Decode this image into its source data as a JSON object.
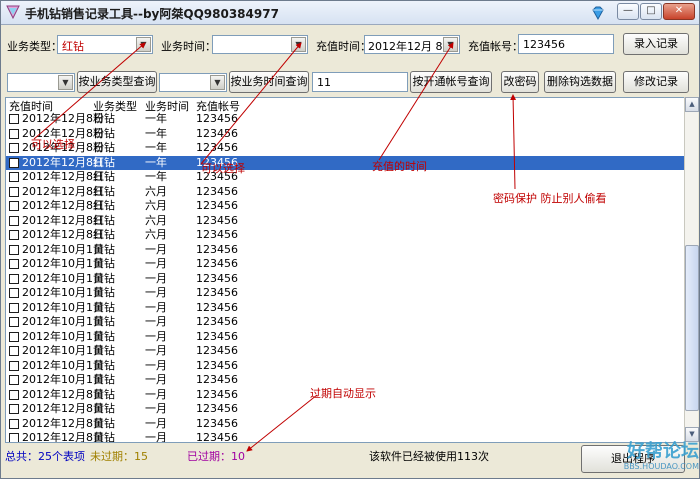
{
  "window": {
    "title": "手机钻销售记录工具--by阿桀QQ980384977",
    "min_glyph": "—",
    "max_glyph": "□",
    "close_glyph": "✕"
  },
  "toolbar": {
    "type_label": "业务类型：",
    "type_value": "红钻",
    "time_label": "业务时间：",
    "time_value": "",
    "recharge_time_label": "充值时间：",
    "recharge_time_value": "2012年12月 8日",
    "account_label": "充值帐号：",
    "account_value": "123456",
    "enter_button": "录入记录"
  },
  "filters": {
    "type_filter_value": "",
    "type_query_button": "按业务类型查询",
    "time_filter_value": "",
    "time_query_button": "按业务时间查询",
    "account_filter_value": "11",
    "account_query_button": "按开通帐号查询",
    "change_password_button": "改密码",
    "delete_checked_button": "删除钩选数据",
    "modify_record_button": "修改记录"
  },
  "table": {
    "columns": [
      "充值时间",
      "业务类型",
      "业务时间",
      "充值帐号"
    ],
    "selected_index": 3,
    "rows": [
      [
        "2012年12月8日",
        "粉钻",
        "一年",
        "123456"
      ],
      [
        "2012年12月8日",
        "粉钻",
        "一年",
        "123456"
      ],
      [
        "2012年12月8日",
        "粉钻",
        "一年",
        "123456"
      ],
      [
        "2012年12月8日",
        "红钻",
        "一年",
        "123456"
      ],
      [
        "2012年12月8日",
        "红钻",
        "一年",
        "123456"
      ],
      [
        "2012年12月8日",
        "红钻",
        "六月",
        "123456"
      ],
      [
        "2012年12月8日",
        "红钻",
        "六月",
        "123456"
      ],
      [
        "2012年12月8日",
        "红钻",
        "六月",
        "123456"
      ],
      [
        "2012年12月8日",
        "红钻",
        "六月",
        "123456"
      ],
      [
        "2012年10月1日",
        "黄钻",
        "一月",
        "123456"
      ],
      [
        "2012年10月1日",
        "黄钻",
        "一月",
        "123456"
      ],
      [
        "2012年10月1日",
        "黄钻",
        "一月",
        "123456"
      ],
      [
        "2012年10月1日",
        "黄钻",
        "一月",
        "123456"
      ],
      [
        "2012年10月1日",
        "黄钻",
        "一月",
        "123456"
      ],
      [
        "2012年10月1日",
        "黄钻",
        "一月",
        "123456"
      ],
      [
        "2012年10月1日",
        "黄钻",
        "一月",
        "123456"
      ],
      [
        "2012年10月1日",
        "黄钻",
        "一月",
        "123456"
      ],
      [
        "2012年10月1日",
        "黄钻",
        "一月",
        "123456"
      ],
      [
        "2012年10月1日",
        "黄钻",
        "一月",
        "123456"
      ],
      [
        "2012年12月8日",
        "黄钻",
        "一月",
        "123456"
      ],
      [
        "2012年12月8日",
        "黄钻",
        "一月",
        "123456"
      ],
      [
        "2012年12月8日",
        "黄钻",
        "一月",
        "123456"
      ],
      [
        "2012年12月8日",
        "黄钻",
        "一月",
        "123456"
      ]
    ]
  },
  "annotations": {
    "selectable": "可以选择",
    "selectable2": "可以选择",
    "recharge_time": "充值的时间",
    "password_protect": "密码保护  防止别人偷看",
    "expired_auto": "过期自动显示"
  },
  "status": {
    "total": "总共：25个表项",
    "not_expired": "未过期：15",
    "expired": "已过期：10",
    "usage": "该软件已经被使用113次",
    "exit_button": "退出程序"
  },
  "watermark": {
    "main": "好帮论坛",
    "sub": "BBS.HOUDAO.COM"
  },
  "colors": {
    "selected_row": "#316ac5",
    "annotation": "#c00000",
    "total_color": "#0000c0",
    "not_expired_color": "#a08000",
    "expired_color": "#a000a0"
  }
}
